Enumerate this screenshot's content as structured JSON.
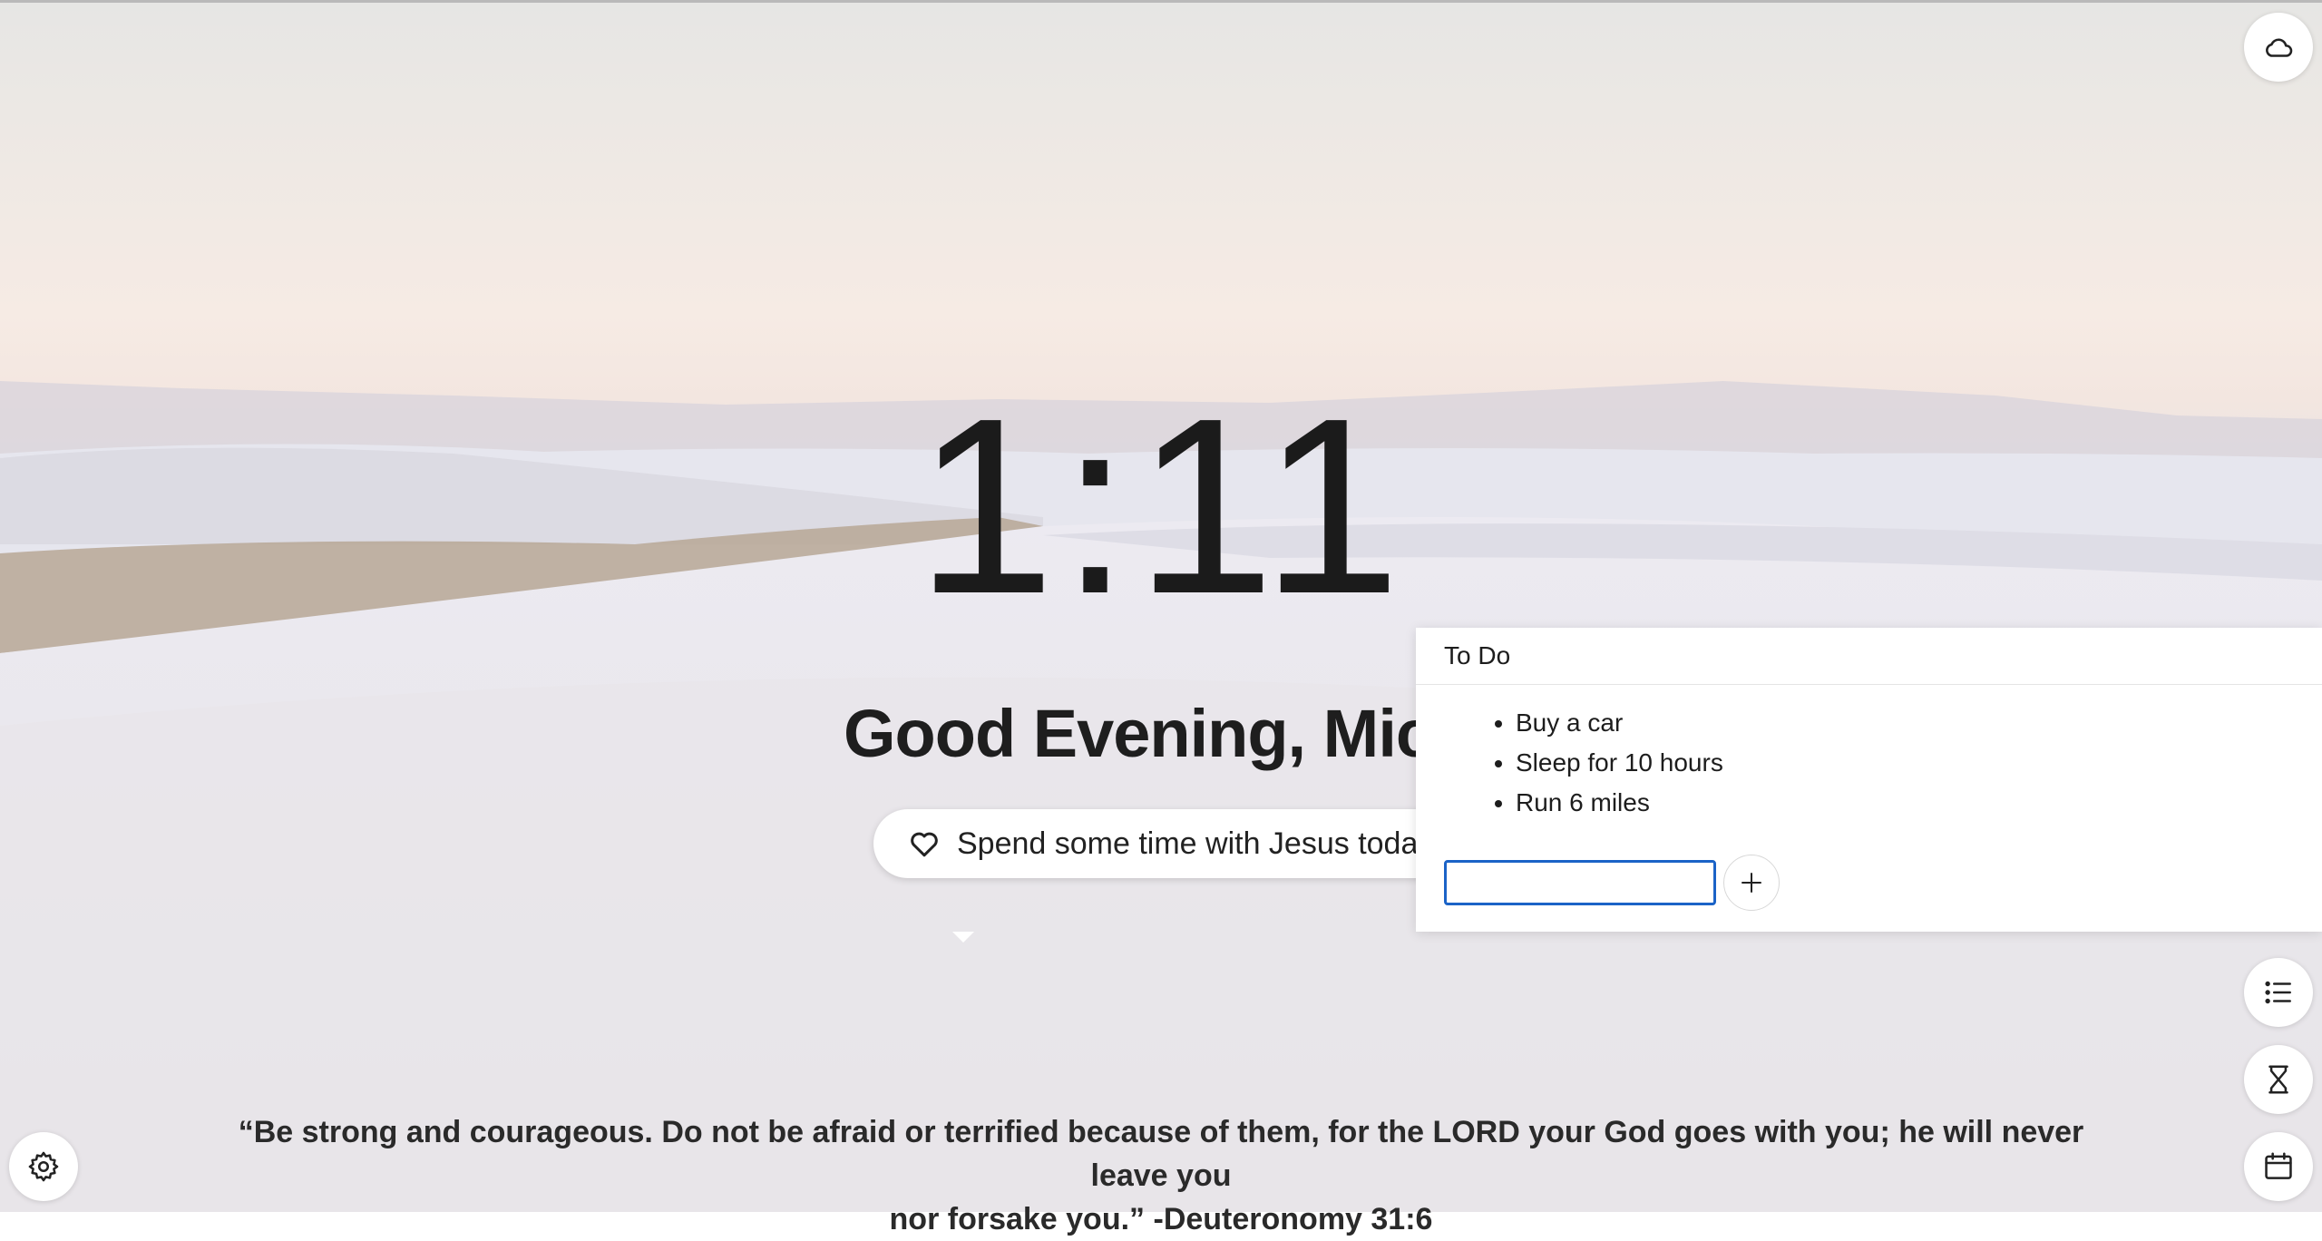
{
  "clock": {
    "time": "1:11"
  },
  "greeting": {
    "text": "Good Evening, Mic"
  },
  "focus": {
    "text": "Spend some time with Jesus today",
    "icon": "heart-icon"
  },
  "quote": {
    "line1": "“Be strong and courageous. Do not be afraid or terrified because of them, for the LORD your God goes with you; he will never leave you",
    "line2": "nor forsake you.” -Deuteronomy 31:6"
  },
  "todo": {
    "title": "To Do",
    "items": [
      "Buy a car",
      "Sleep for 10 hours",
      "Run 6 miles"
    ],
    "input_value": "",
    "add_icon": "plus-icon"
  },
  "icons": {
    "weather": "cloud-icon",
    "todo": "list-icon",
    "timer": "hourglass-icon",
    "calendar": "calendar-icon",
    "settings": "gear-icon"
  },
  "colors": {
    "input_border": "#1b63c7",
    "text_dark": "#1b1b1b"
  }
}
